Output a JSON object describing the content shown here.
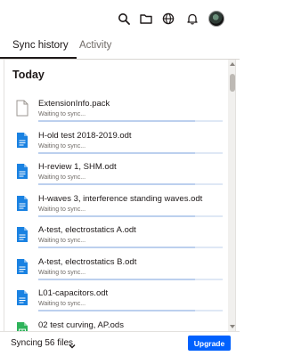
{
  "header": {
    "icons": [
      "search-icon",
      "folder-icon",
      "globe-icon",
      "bell-icon",
      "avatar"
    ]
  },
  "tabs": [
    {
      "label": "Sync history",
      "active": true
    },
    {
      "label": "Activity",
      "active": false
    }
  ],
  "section": {
    "title": "Today"
  },
  "files": [
    {
      "name": "ExtensionInfo.pack",
      "status": "Waiting to sync...",
      "type": "generic",
      "progress": 0.85
    },
    {
      "name": "H-old test 2018-2019.odt",
      "status": "Waiting to sync...",
      "type": "document",
      "progress": 0.85
    },
    {
      "name": "H-review 1, SHM.odt",
      "status": "Waiting to sync...",
      "type": "document",
      "progress": 0.85
    },
    {
      "name": "H-waves 3, interference standing waves.odt",
      "status": "Waiting to sync...",
      "type": "document",
      "progress": 0.85
    },
    {
      "name": "A-test, electrostatics A.odt",
      "status": "Waiting to sync...",
      "type": "document",
      "progress": 0.85
    },
    {
      "name": "A-test, electrostatics B.odt",
      "status": "Waiting to sync...",
      "type": "document",
      "progress": 0.85
    },
    {
      "name": "L01-capacitors.odt",
      "status": "Waiting to sync...",
      "type": "document",
      "progress": 0.85
    },
    {
      "name": "02 test curving, AP.ods",
      "status": "Waiting to sync...",
      "type": "spreadsheet",
      "progress": 0.85
    }
  ],
  "footer": {
    "sync_status": "Syncing 56 files",
    "upgrade_label": "Upgrade"
  },
  "colors": {
    "accent": "#0061fe",
    "document_icon": "#1a82e2",
    "spreadsheet_icon": "#2eb35a",
    "progress": "#bcd0ee"
  }
}
